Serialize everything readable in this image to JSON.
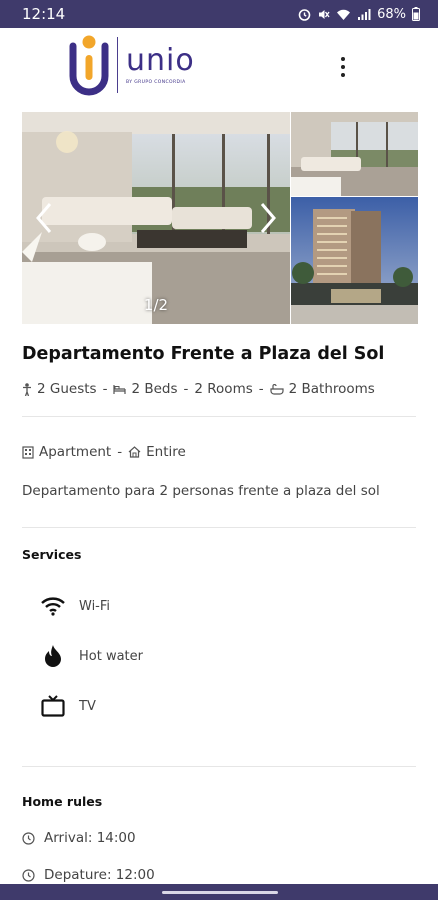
{
  "status_bar": {
    "time": "12:14",
    "battery": "68%"
  },
  "header": {
    "logo_text": "unio",
    "logo_subtext": "BY GRUPO CONCORDIA",
    "menu_icon": "more-vert-icon"
  },
  "gallery": {
    "counter": "1/2",
    "prev_icon": "chevron-left-icon",
    "next_icon": "chevron-right-icon"
  },
  "listing": {
    "title": "Departamento Frente a Plaza del Sol",
    "guests": "2 Guests",
    "beds": "2 Beds",
    "rooms": "2 Rooms",
    "bathrooms": "2 Bathrooms",
    "separator": "-",
    "type": "Apartment",
    "space": "Entire",
    "description": "Departamento para 2 personas frente a plaza del sol"
  },
  "services": {
    "title": "Services",
    "items": [
      {
        "label": "Wi-Fi",
        "icon": "wifi-icon"
      },
      {
        "label": "Hot water",
        "icon": "flame-icon"
      },
      {
        "label": "TV",
        "icon": "tv-icon"
      }
    ]
  },
  "home_rules": {
    "title": "Home rules",
    "arrival": "Arrival: 14:00",
    "departure": "Depature: 12:00"
  },
  "colors": {
    "brand": "#3c2f86",
    "accent": "#f2a62a",
    "system_bar": "#3f3a6b"
  }
}
